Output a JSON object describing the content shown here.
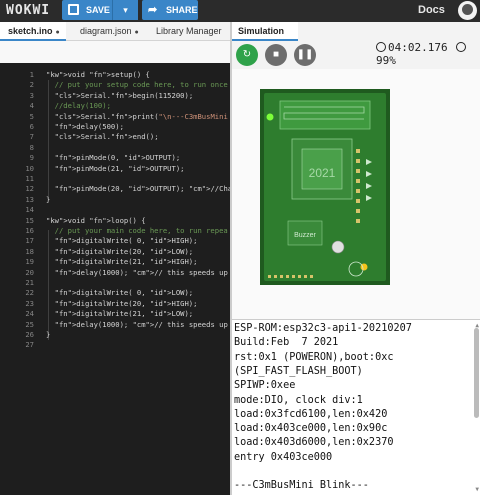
{
  "app": {
    "logo": "WOKWI",
    "docs": "Docs"
  },
  "toolbar": {
    "save_label": "SAVE",
    "share_label": "SHARE",
    "save_icon": "save-icon",
    "share_icon": "share-icon",
    "dropdown_icon": "chevron-down-icon"
  },
  "editor_tabs": [
    {
      "label": "sketch.ino",
      "active": true
    },
    {
      "label": "diagram.json",
      "active": false
    },
    {
      "label": "Library Manager",
      "active": false
    }
  ],
  "code_lines": [
    {
      "n": "1",
      "text": "void setup() {"
    },
    {
      "n": "2",
      "text": "  // put your setup code here, to run once"
    },
    {
      "n": "3",
      "text": "  Serial.begin(115200);"
    },
    {
      "n": "4",
      "text": "  //delay(100);"
    },
    {
      "n": "5",
      "text": "  Serial.print(\"\\n---C3mBusMini Blink---\");"
    },
    {
      "n": "6",
      "text": "  delay(500);"
    },
    {
      "n": "7",
      "text": "  Serial.end();"
    },
    {
      "n": "8",
      "text": ""
    },
    {
      "n": "9",
      "text": "  pinMode(0, OUTPUT);"
    },
    {
      "n": "10",
      "text": "  pinMode(21, OUTPUT);"
    },
    {
      "n": "11",
      "text": ""
    },
    {
      "n": "12",
      "text": "  pinMode(20, OUTPUT); //Change RX20 to Ou"
    },
    {
      "n": "13",
      "text": "}"
    },
    {
      "n": "14",
      "text": ""
    },
    {
      "n": "15",
      "text": "void loop() {"
    },
    {
      "n": "16",
      "text": "  // put your main code here, to run repea"
    },
    {
      "n": "17",
      "text": "  digitalWrite( 0, HIGH);"
    },
    {
      "n": "18",
      "text": "  digitalWrite(20, LOW);"
    },
    {
      "n": "19",
      "text": "  digitalWrite(21, HIGH);"
    },
    {
      "n": "20",
      "text": "  delay(1000); // this speeds up the simul"
    },
    {
      "n": "21",
      "text": ""
    },
    {
      "n": "22",
      "text": "  digitalWrite( 0, LOW);"
    },
    {
      "n": "23",
      "text": "  digitalWrite(20, HIGH);"
    },
    {
      "n": "24",
      "text": "  digitalWrite(21, LOW);"
    },
    {
      "n": "25",
      "text": "  delay(1000); // this speeds up the simul"
    },
    {
      "n": "26",
      "text": "}"
    },
    {
      "n": "27",
      "text": ""
    }
  ],
  "simulation": {
    "tab_label": "Simulation",
    "timer": "04:02.176",
    "cpu": "99%",
    "restart_icon": "restart-icon",
    "stop_icon": "stop-icon",
    "pause_icon": "pause-icon",
    "board_labels": {
      "year": "2021",
      "buzzer": "Buzzer"
    }
  },
  "serial_lines": [
    "ESP-ROM:esp32c3-api1-20210207",
    "Build:Feb  7 2021",
    "rst:0x1 (POWERON),boot:0xc",
    "(SPI_FAST_FLASH_BOOT)",
    "SPIWP:0xee",
    "mode:DIO, clock div:1",
    "load:0x3fcd6100,len:0x420",
    "load:0x403ce000,len:0x90c",
    "load:0x403d6000,len:0x2370",
    "entry 0x403ce000",
    "",
    "---C3mBusMini Blink---"
  ],
  "colors": {
    "accent": "#3a86c8",
    "run_green": "#2fa24a",
    "pcb_green": "#2e7d2e"
  }
}
